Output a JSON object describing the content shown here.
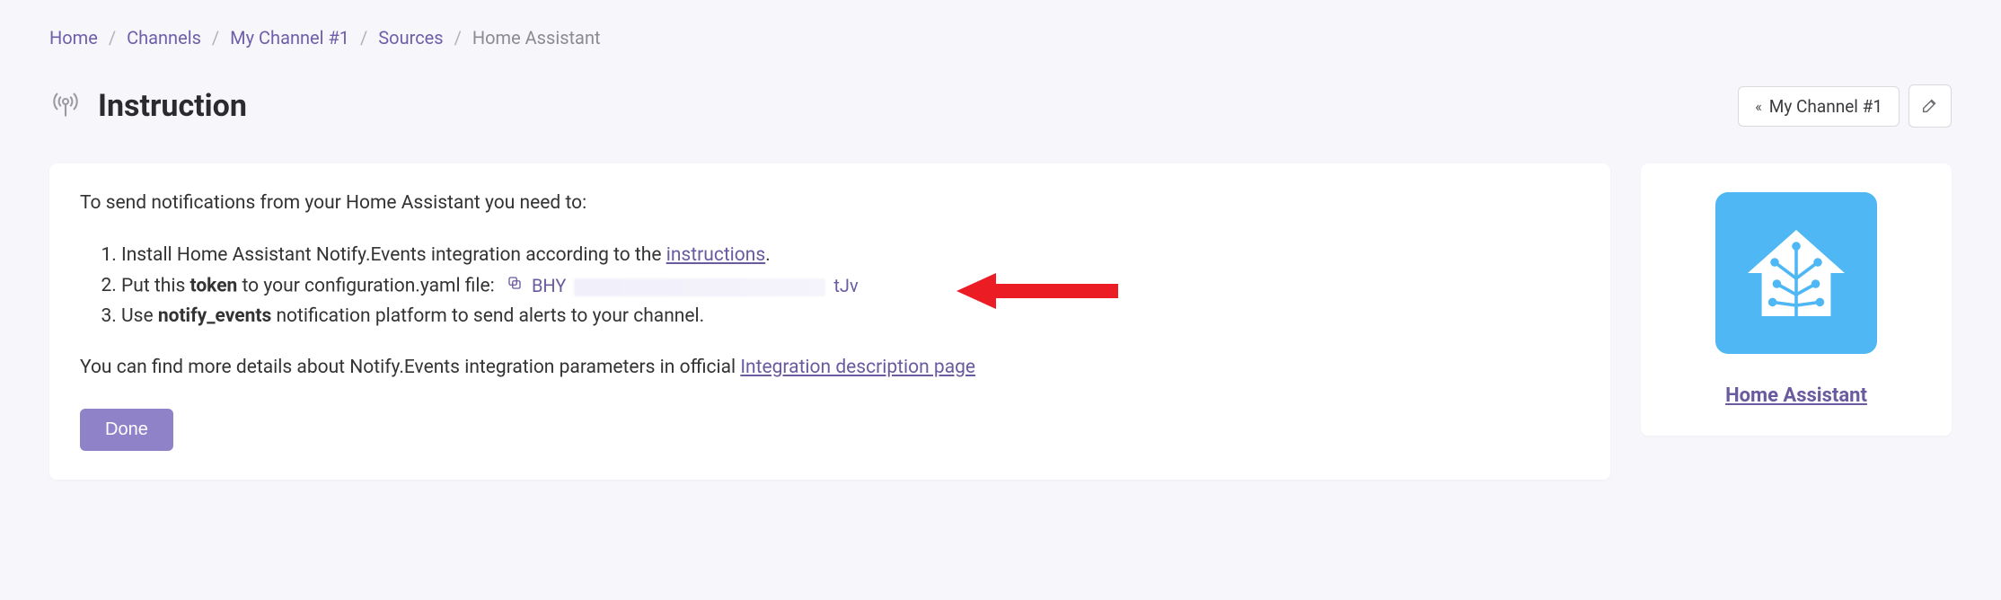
{
  "breadcrumb": {
    "home": "Home",
    "channels": "Channels",
    "channel": "My Channel #1",
    "sources": "Sources",
    "current": "Home Assistant"
  },
  "header": {
    "title": "Instruction",
    "channel_chip": "My Channel #1"
  },
  "main": {
    "intro": "To send notifications from your Home Assistant you need to:",
    "step1_before": "Install Home Assistant Notify.Events integration according to the ",
    "step1_link": "instructions",
    "step1_after": ".",
    "step2_before": "Put this ",
    "step2_bold": "token",
    "step2_after": " to your configuration.yaml file:",
    "token_prefix": "BHY",
    "token_suffix": "tJv",
    "step3_before": "Use ",
    "step3_bold": "notify_events",
    "step3_after": " notification platform to send alerts to your channel.",
    "details_before": "You can find more details about Notify.Events integration parameters in official ",
    "details_link": "Integration description page",
    "done": "Done"
  },
  "side": {
    "link": "Home Assistant"
  },
  "colors": {
    "accent": "#6a5a9e",
    "button": "#8f82c8",
    "badge": "#4fb8f4",
    "arrow": "#ec1c24"
  }
}
